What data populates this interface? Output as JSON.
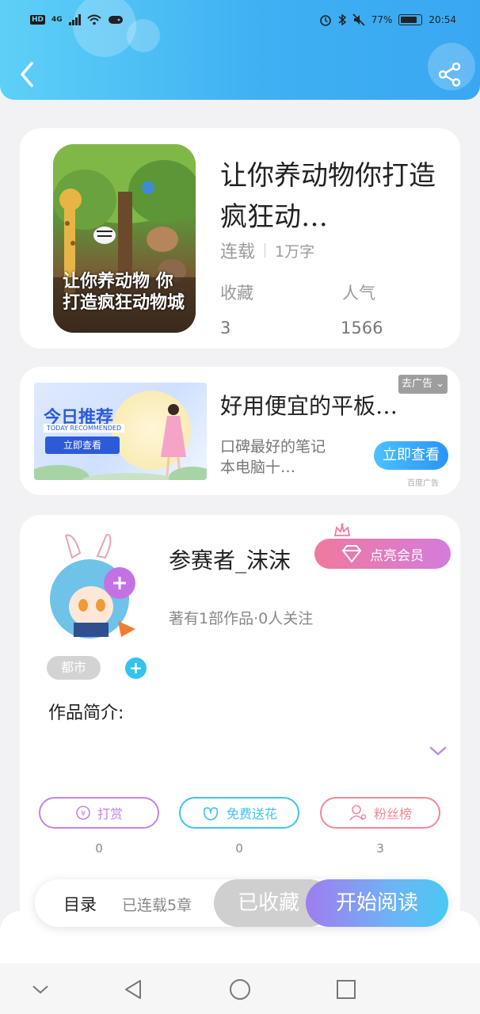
{
  "status_bar": {
    "network": "4G",
    "battery_percent": "77%",
    "time": "20:54"
  },
  "book": {
    "title": "让你养动物你打造疯狂动…",
    "status": "连载",
    "word_count": "1万字",
    "favorites_label": "收藏",
    "favorites_value": "3",
    "popularity_label": "人气",
    "popularity_value": "1566",
    "cover_text": "让你养动物 你打造疯狂动物城"
  },
  "ad": {
    "image_title": "今日推荐",
    "image_subtitle": "TODAY RECOMMENDED",
    "image_button": "立即查看",
    "title": "好用便宜的平板…",
    "description": "口碑最好的笔记本电脑十…",
    "close_label": "去广告",
    "view_button": "立即查看",
    "ad_mark": "百度广告"
  },
  "author": {
    "name": "参赛者_沫沫",
    "vip_button": "点亮会员",
    "info": "著有1部作品·0人关注",
    "tag": "都市",
    "intro_label": "作品简介:"
  },
  "actions": [
    {
      "label": "打赏",
      "count": "0",
      "color": "#c184e6"
    },
    {
      "label": "免费送花",
      "count": "0",
      "color": "#3ec4ec"
    },
    {
      "label": "粉丝榜",
      "count": "3",
      "color": "#f0889a"
    }
  ],
  "read_bar": {
    "toc_label": "目录",
    "chapters": "已连载5章",
    "collected_label": "已收藏",
    "start_label": "开始阅读"
  }
}
